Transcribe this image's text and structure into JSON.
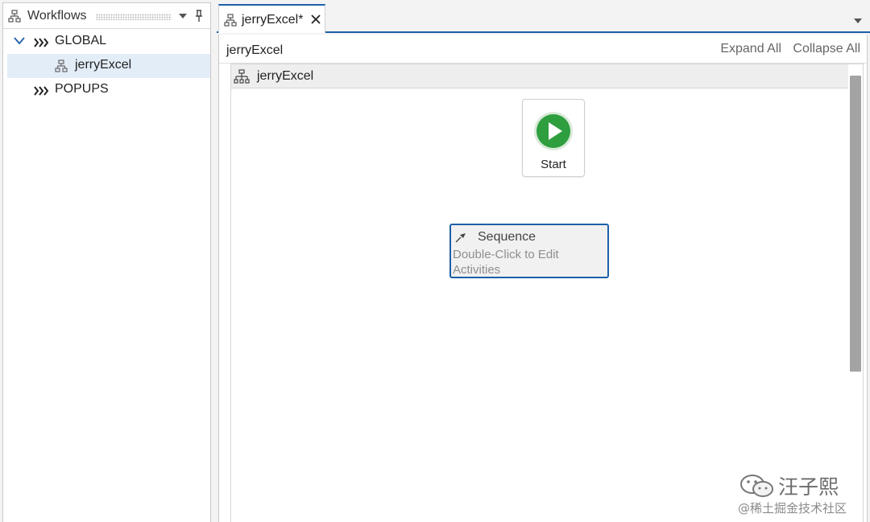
{
  "workflows_panel": {
    "title": "Workflows",
    "icon": "workflow-icon",
    "tree": [
      {
        "label": "GLOBAL",
        "expanded": true,
        "icon": "double-chevron-icon"
      },
      {
        "label": "jerryExcel",
        "selected": true,
        "icon": "workflow-icon"
      },
      {
        "label": "POPUPS",
        "expanded": false,
        "icon": "double-chevron-icon"
      }
    ]
  },
  "editor": {
    "tab": {
      "label": "jerryExcel*",
      "icon": "workflow-icon"
    },
    "breadcrumb": "jerryExcel",
    "expand_all": "Expand All",
    "collapse_all": "Collapse All",
    "designer_title": "jerryExcel",
    "start_label": "Start",
    "sequence": {
      "title": "Sequence",
      "hint": "Double-Click to Edit Activities"
    }
  },
  "watermark": {
    "name": "汪子熙",
    "sub": "@稀土掘金技术社区"
  },
  "colors": {
    "accent": "#1d5fa8",
    "start_green": "#2e9e3f",
    "selection": "#e3edf8"
  }
}
